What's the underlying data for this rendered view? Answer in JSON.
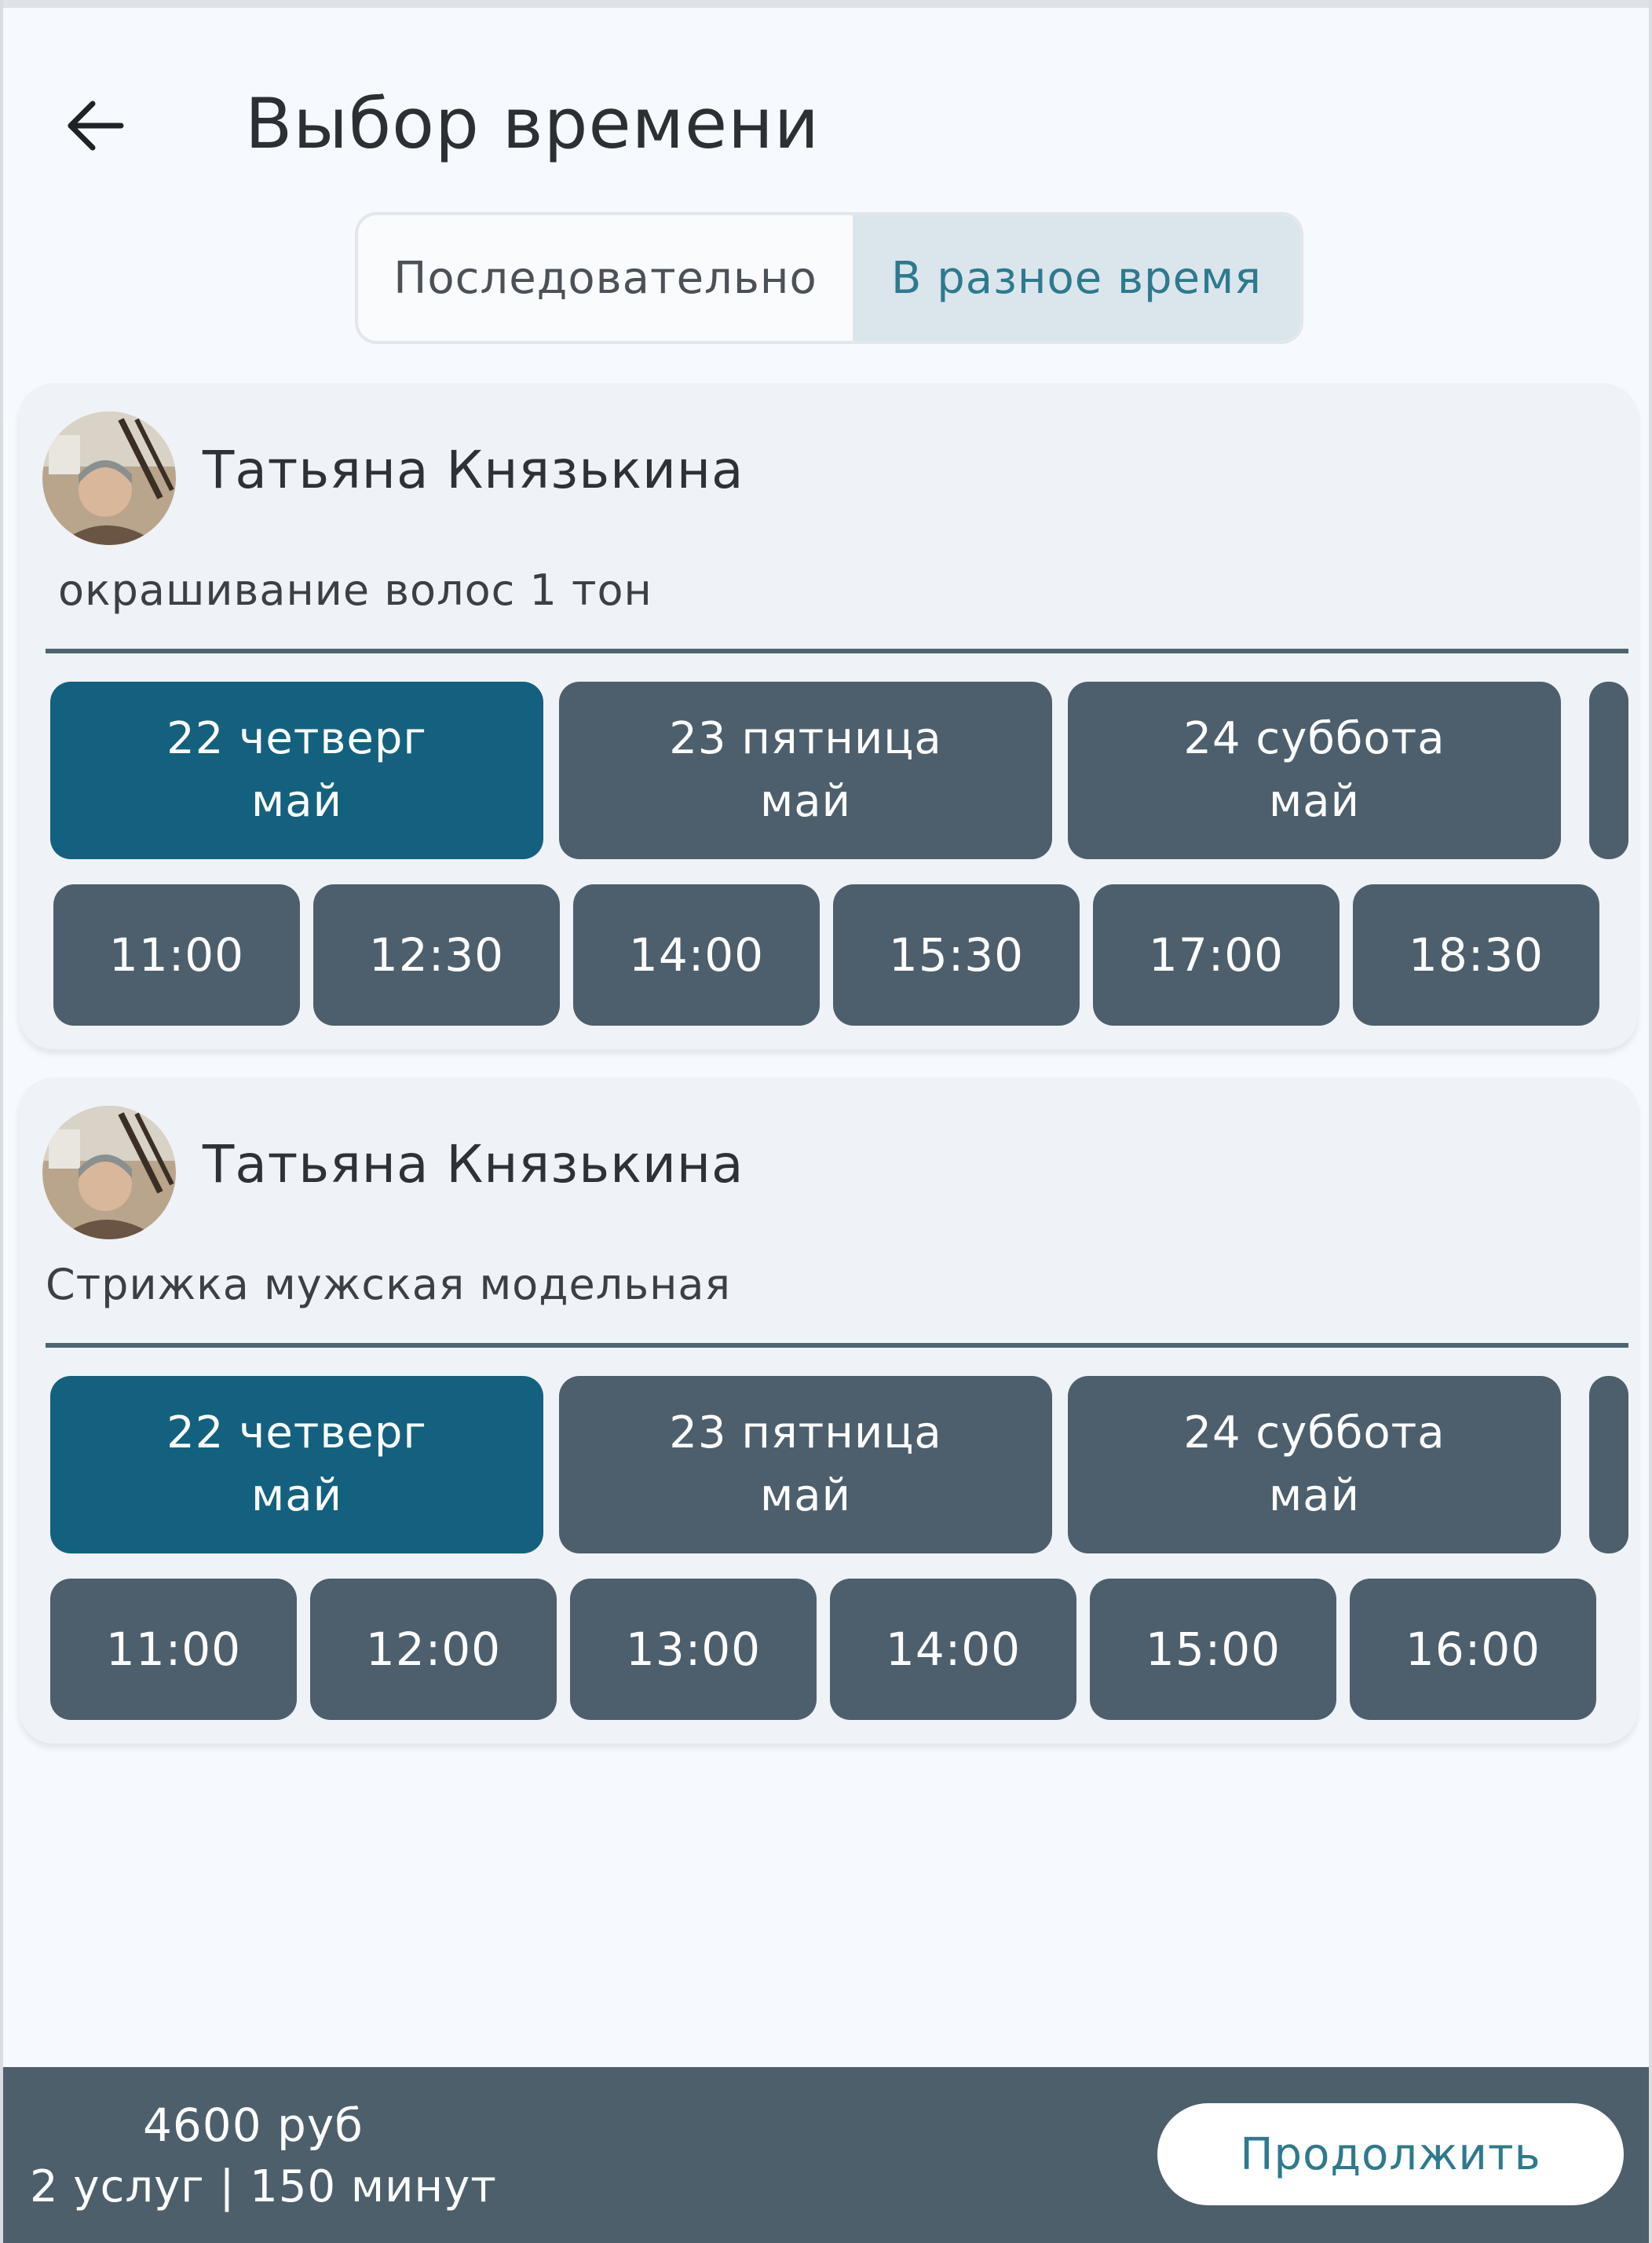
{
  "header": {
    "title": "Выбор времени",
    "back_icon": "arrow-left-icon"
  },
  "mode_toggle": {
    "options": [
      {
        "label": "Последовательно",
        "selected": false
      },
      {
        "label": "В разное время",
        "selected": true
      }
    ]
  },
  "bookings": [
    {
      "master_name": "Татьяна Князькина",
      "service": "окрашивание волос 1 тон",
      "dates": [
        {
          "day": "22 четверг",
          "month": "май",
          "selected": true
        },
        {
          "day": "23 пятница",
          "month": "май",
          "selected": false
        },
        {
          "day": "24 суббота",
          "month": "май",
          "selected": false
        }
      ],
      "times": [
        "11:00",
        "12:30",
        "14:00",
        "15:30",
        "17:00",
        "18:30"
      ]
    },
    {
      "master_name": "Татьяна Князькина",
      "service": "Стрижка мужская модельная",
      "dates": [
        {
          "day": "22 четверг",
          "month": "май",
          "selected": true
        },
        {
          "day": "23 пятница",
          "month": "май",
          "selected": false
        },
        {
          "day": "24 суббота",
          "month": "май",
          "selected": false
        }
      ],
      "times": [
        "11:00",
        "12:00",
        "13:00",
        "14:00",
        "15:00",
        "16:00"
      ]
    }
  ],
  "footer": {
    "price": "4600 руб",
    "summary": "2 услуг | 150 минут",
    "continue_label": "Продолжить"
  },
  "colors": {
    "accent": "#13617e",
    "chip": "#4d5f6c",
    "toggle_active_bg": "#dbe5ec",
    "toggle_active_text": "#2d7a8f",
    "footer_bg": "#4d5f6b"
  }
}
